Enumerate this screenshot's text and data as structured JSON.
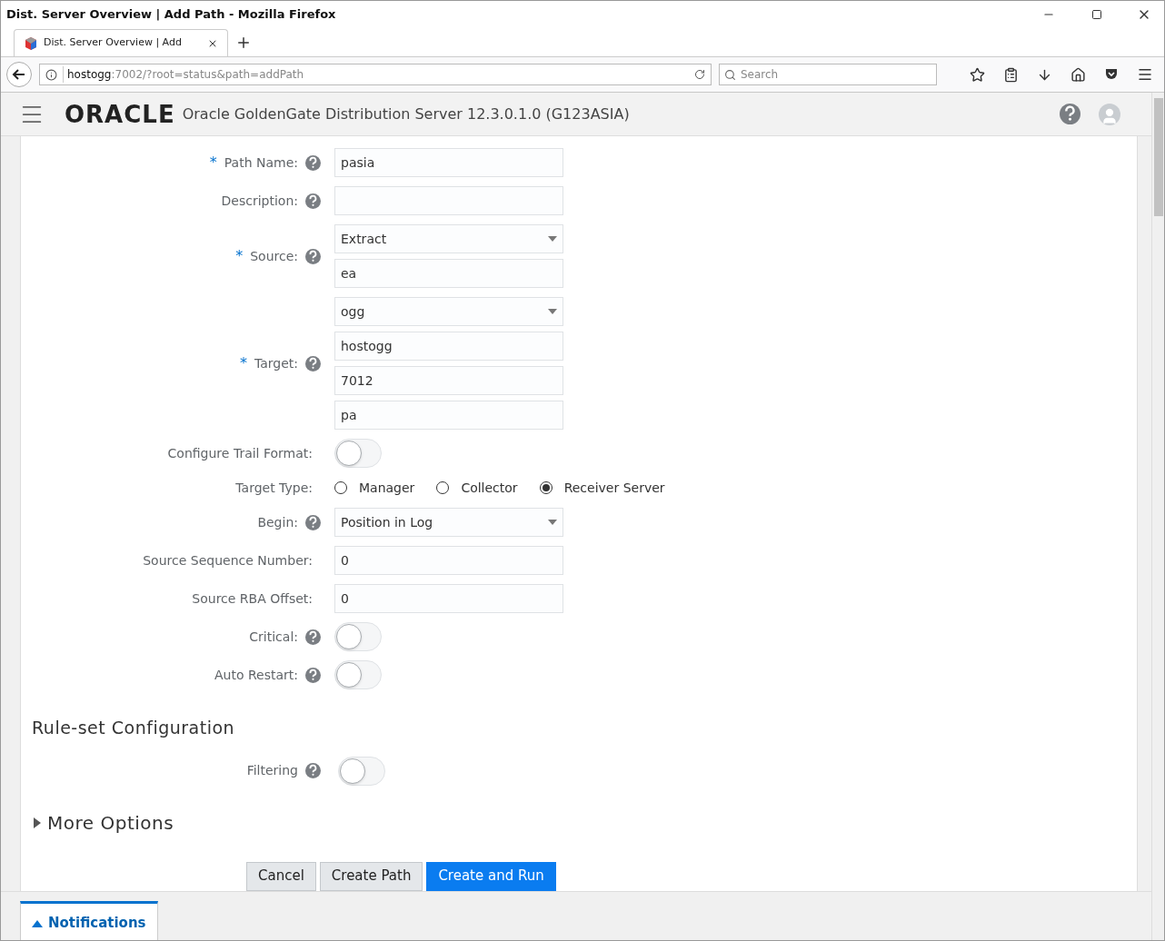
{
  "window": {
    "title": "Dist. Server Overview | Add Path - Mozilla Firefox"
  },
  "browser_tab": {
    "title": "Dist. Server Overview | Add",
    "selected": true
  },
  "address_bar": {
    "host": "hostogg",
    "path": ":7002/?root=status&path=addPath"
  },
  "search": {
    "placeholder": "Search"
  },
  "app_header": {
    "logo": "ORACLE",
    "title": "Oracle GoldenGate Distribution Server 12.3.0.1.0 (G123ASIA)"
  },
  "form": [
    {
      "kind": "fields",
      "required_mark": "*",
      "label": "Path Name:",
      "help": true,
      "fields": [
        {
          "kind": "input",
          "value": "pasia"
        }
      ]
    },
    {
      "kind": "fields",
      "label": "Description:",
      "help": true,
      "fields": [
        {
          "kind": "input"
        }
      ]
    },
    {
      "kind": "fields",
      "required_mark": "*",
      "label": "Source:",
      "help": true,
      "fields": [
        {
          "kind": "select",
          "value": "Extract"
        },
        {
          "kind": "input",
          "value": "ea"
        }
      ]
    },
    {
      "kind": "fields",
      "required_mark": "*",
      "label": "Target:",
      "help": true,
      "fields": [
        {
          "kind": "select",
          "value": "ogg"
        },
        {
          "kind": "input",
          "value": "hostogg"
        },
        {
          "kind": "input",
          "value": "7012"
        },
        {
          "kind": "input",
          "value": "pa"
        }
      ]
    },
    {
      "kind": "toggle",
      "label": "Configure Trail Format:",
      "help": false,
      "on": false
    },
    {
      "kind": "radio",
      "label": "Target Type:",
      "help": false,
      "options": [
        {
          "label": "Manager",
          "selected": false
        },
        {
          "label": "Collector",
          "selected": false
        },
        {
          "label": "Receiver Server",
          "selected": true
        }
      ]
    },
    {
      "kind": "fields",
      "label": "Begin:",
      "help": true,
      "fields": [
        {
          "kind": "select",
          "value": "Position in Log"
        }
      ]
    },
    {
      "kind": "fields",
      "label": "Source Sequence Number:",
      "help": false,
      "fields": [
        {
          "kind": "input",
          "value": "0"
        }
      ]
    },
    {
      "kind": "fields",
      "label": "Source RBA Offset:",
      "help": false,
      "fields": [
        {
          "kind": "input",
          "value": "0"
        }
      ]
    },
    {
      "kind": "toggle",
      "label": "Critical:",
      "help": true,
      "on": false
    },
    {
      "kind": "toggle",
      "label": "Auto Restart:",
      "help": true,
      "on": false
    }
  ],
  "rule_set": {
    "heading": "Rule-set Configuration",
    "filtering": {
      "label": "Filtering",
      "on": false
    }
  },
  "more_options": {
    "label": "More Options",
    "expanded": false
  },
  "buttons": [
    {
      "label": "Cancel",
      "kind": "secondary"
    },
    {
      "label": "Create Path",
      "kind": "secondary"
    },
    {
      "label": "Create and Run",
      "kind": "primary"
    }
  ],
  "notifications": {
    "label": "Notifications",
    "expanded": false
  }
}
